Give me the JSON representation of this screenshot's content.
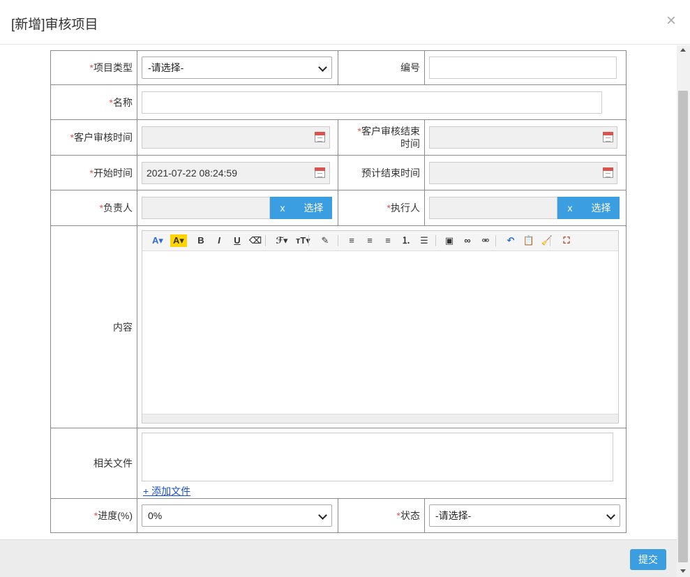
{
  "dialog": {
    "title": "[新增]审核项目",
    "close_glyph": "×"
  },
  "form": {
    "required_mark": "*",
    "project_type": {
      "label": "项目类型",
      "value": "-请选择-"
    },
    "number": {
      "label": "编号",
      "value": ""
    },
    "name": {
      "label": "名称",
      "value": ""
    },
    "client_audit_time": {
      "label": "客户审核时间",
      "value": ""
    },
    "client_audit_end": {
      "label_line1": "客户审核结束",
      "label_line2": "时间",
      "value": ""
    },
    "start_time": {
      "label": "开始时间",
      "value": "2021-07-22 08:24:59"
    },
    "planned_end": {
      "label": "预计结束时间",
      "value": ""
    },
    "owner": {
      "label": "负责人",
      "value": "",
      "clear_label": "x",
      "choose_label": "选择"
    },
    "executor": {
      "label": "执行人",
      "value": "",
      "clear_label": "x",
      "choose_label": "选择"
    },
    "content": {
      "label": "内容"
    },
    "files": {
      "label": "相关文件",
      "add_label": "+ 添加文件"
    },
    "progress": {
      "label": "进度(%)",
      "value": "0%"
    },
    "status": {
      "label": "状态",
      "value": "-请选择-"
    }
  },
  "editor_toolbar": [
    {
      "name": "font-color-icon",
      "glyph": "A▾"
    },
    {
      "name": "highlight-icon",
      "glyph": "A▾"
    },
    {
      "name": "bold-icon",
      "glyph": "B"
    },
    {
      "name": "italic-icon",
      "glyph": "I"
    },
    {
      "name": "underline-icon",
      "glyph": "U"
    },
    {
      "name": "eraser-icon",
      "glyph": "⌫"
    },
    {
      "name": "font-family-icon",
      "glyph": "ℱ▾"
    },
    {
      "name": "font-size-icon",
      "glyph": "ᴛT▾"
    },
    {
      "name": "format-painter-icon",
      "glyph": "✎"
    },
    {
      "name": "align-left-icon",
      "glyph": "≡"
    },
    {
      "name": "align-center-icon",
      "glyph": "≡"
    },
    {
      "name": "align-right-icon",
      "glyph": "≡"
    },
    {
      "name": "ordered-list-icon",
      "glyph": "⒈"
    },
    {
      "name": "unordered-list-icon",
      "glyph": "☰"
    },
    {
      "name": "image-icon",
      "glyph": "▣"
    },
    {
      "name": "link-icon",
      "glyph": "∞"
    },
    {
      "name": "unlink-icon",
      "glyph": "⚮"
    },
    {
      "name": "undo-icon",
      "glyph": "↶"
    },
    {
      "name": "paste-icon",
      "glyph": "📋"
    },
    {
      "name": "clean-icon",
      "glyph": "🧹"
    },
    {
      "name": "fullscreen-icon",
      "glyph": "⛶"
    }
  ],
  "footer": {
    "submit_label": "提交"
  },
  "colors": {
    "accent": "#3a9ee0",
    "required": "#d9534f"
  }
}
